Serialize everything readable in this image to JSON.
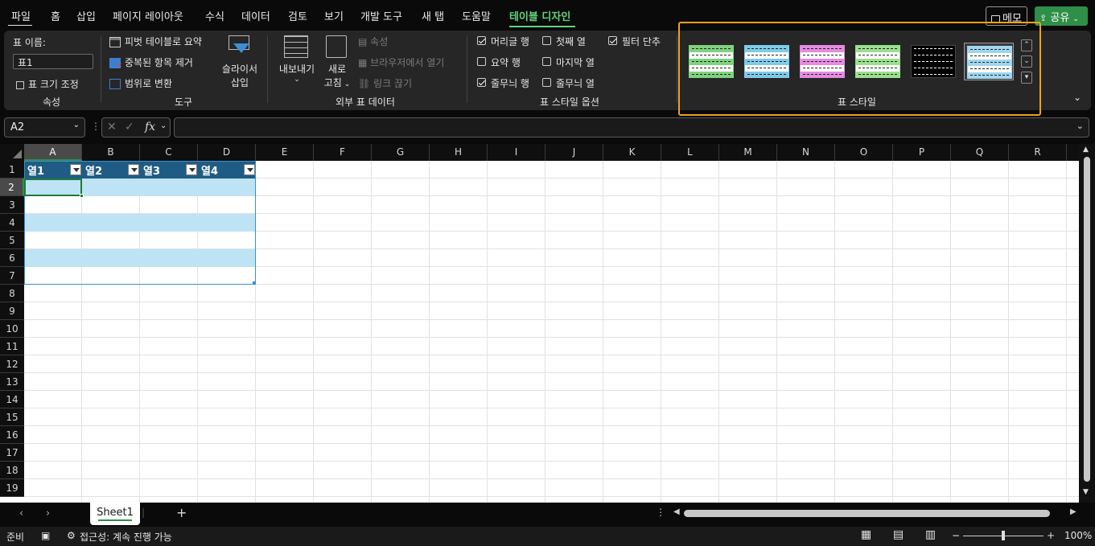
{
  "menu": {
    "tabs": [
      {
        "label": "파일"
      },
      {
        "label": "홈"
      },
      {
        "label": "삽입"
      },
      {
        "label": "페이지 레이아웃"
      },
      {
        "label": "수식"
      },
      {
        "label": "데이터"
      },
      {
        "label": "검토"
      },
      {
        "label": "보기"
      },
      {
        "label": "개발 도구"
      },
      {
        "label": "새 탭"
      },
      {
        "label": "도움말"
      },
      {
        "label": "테이블 디자인"
      }
    ],
    "active_tab": "테이블 디자인",
    "memo_label": "메모",
    "share_label": "공유"
  },
  "ribbon": {
    "properties": {
      "name_label": "표 이름:",
      "name_value": "표1",
      "resize_label": "표 크기 조정",
      "group_label": "속성"
    },
    "tools": {
      "pivot_label": "피벗 테이블로 요약",
      "remove_dup_label": "중복된 항목 제거",
      "convert_label": "범위로 변환",
      "slicer_line1": "슬라이서",
      "slicer_line2": "삽입",
      "group_label": "도구"
    },
    "external": {
      "export_label": "내보내기",
      "refresh_line1": "새로",
      "refresh_line2": "고침",
      "properties_label": "속성",
      "open_browser_label": "브라우저에서 열기",
      "unlink_label": "링크 끊기",
      "group_label": "외부 표 데이터"
    },
    "style_options": {
      "header_row": {
        "label": "머리글 행",
        "checked": true
      },
      "total_row": {
        "label": "요약 행",
        "checked": false
      },
      "banded_rows": {
        "label": "줄무늬 행",
        "checked": true
      },
      "first_column": {
        "label": "첫째 열",
        "checked": false
      },
      "last_column": {
        "label": "마지막 열",
        "checked": false
      },
      "banded_columns": {
        "label": "줄무늬 열",
        "checked": false
      },
      "filter_button": {
        "label": "필터 단추",
        "checked": true
      },
      "group_label": "표 스타일 옵션"
    },
    "table_styles": {
      "group_label": "표 스타일",
      "swatches": [
        {
          "name": "green-light",
          "color": "#7fd37f"
        },
        {
          "name": "blue-light",
          "color": "#7fcbe8"
        },
        {
          "name": "pink-light",
          "color": "#e58be0"
        },
        {
          "name": "green-grid",
          "color": "#9be08f"
        },
        {
          "name": "black-dark",
          "color": "#000000"
        },
        {
          "name": "blue-selected",
          "color": "#9fd6ee"
        }
      ],
      "selected": "blue-selected"
    }
  },
  "formula_bar": {
    "name_box": "A2",
    "fx_label": "fx",
    "formula": ""
  },
  "grid": {
    "columns": [
      "A",
      "B",
      "C",
      "D",
      "E",
      "F",
      "G",
      "H",
      "I",
      "J",
      "K",
      "L",
      "M",
      "N",
      "O",
      "P",
      "Q",
      "R"
    ],
    "rows": [
      "1",
      "2",
      "3",
      "4",
      "5",
      "6",
      "7",
      "8",
      "9",
      "10",
      "11",
      "12",
      "13",
      "14",
      "15",
      "16",
      "17",
      "18",
      "19"
    ],
    "selected_column": "A",
    "selected_row": "2",
    "table_headers": [
      "열1",
      "열2",
      "열3",
      "열4"
    ]
  },
  "sheets": {
    "tabs": [
      "Sheet1"
    ],
    "active": "Sheet1",
    "add_label": "+"
  },
  "status": {
    "ready": "준비",
    "accessibility": "접근성: 계속 진행 가능",
    "zoom": "100%"
  },
  "colors": {
    "accent": "#5fd17a",
    "table_header": "#1f5c85",
    "table_band": "#bee3f4",
    "highlight": "#f0a020"
  }
}
